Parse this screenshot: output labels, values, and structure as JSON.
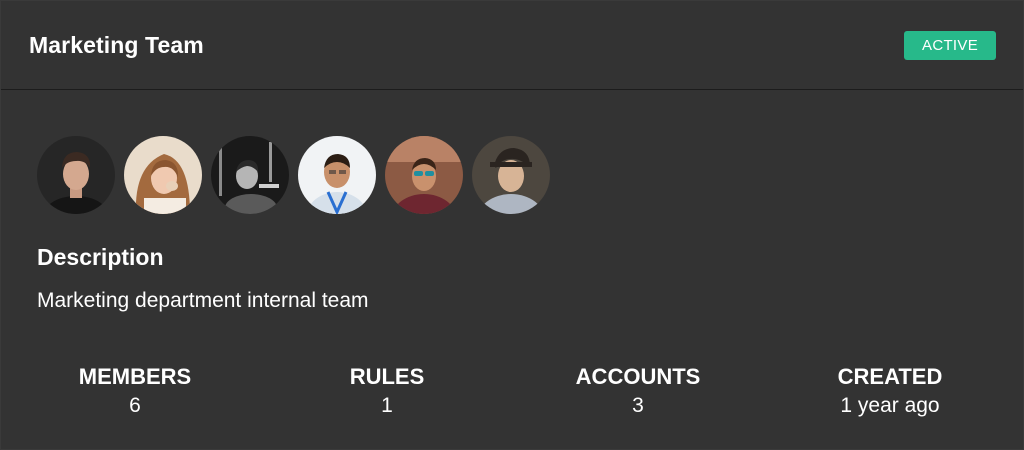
{
  "team": {
    "title": "Marketing Team",
    "status": "ACTIVE",
    "status_color": "#27b98a"
  },
  "members": [
    {
      "icon": "member-avatar-1"
    },
    {
      "icon": "member-avatar-2"
    },
    {
      "icon": "member-avatar-3"
    },
    {
      "icon": "member-avatar-4"
    },
    {
      "icon": "member-avatar-5"
    },
    {
      "icon": "member-avatar-6"
    }
  ],
  "description": {
    "heading": "Description",
    "text": "Marketing department internal team"
  },
  "stats": [
    {
      "label": "MEMBERS",
      "value": "6"
    },
    {
      "label": "RULES",
      "value": "1"
    },
    {
      "label": "ACCOUNTS",
      "value": "3"
    },
    {
      "label": "CREATED",
      "value": "1 year ago"
    }
  ]
}
